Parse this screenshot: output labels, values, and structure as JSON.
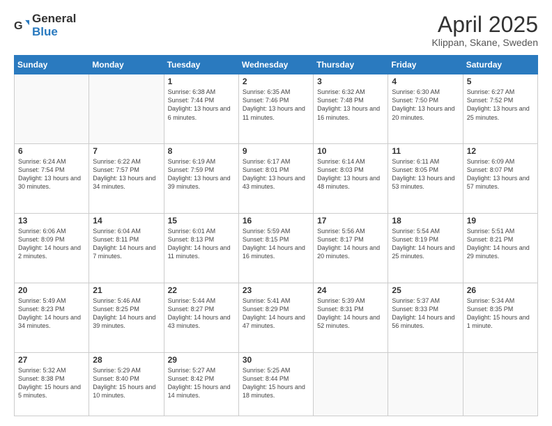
{
  "logo": {
    "general": "General",
    "blue": "Blue"
  },
  "header": {
    "title": "April 2025",
    "subtitle": "Klippan, Skane, Sweden"
  },
  "weekdays": [
    "Sunday",
    "Monday",
    "Tuesday",
    "Wednesday",
    "Thursday",
    "Friday",
    "Saturday"
  ],
  "weeks": [
    [
      {
        "day": "",
        "info": ""
      },
      {
        "day": "",
        "info": ""
      },
      {
        "day": "1",
        "info": "Sunrise: 6:38 AM\nSunset: 7:44 PM\nDaylight: 13 hours and 6 minutes."
      },
      {
        "day": "2",
        "info": "Sunrise: 6:35 AM\nSunset: 7:46 PM\nDaylight: 13 hours and 11 minutes."
      },
      {
        "day": "3",
        "info": "Sunrise: 6:32 AM\nSunset: 7:48 PM\nDaylight: 13 hours and 16 minutes."
      },
      {
        "day": "4",
        "info": "Sunrise: 6:30 AM\nSunset: 7:50 PM\nDaylight: 13 hours and 20 minutes."
      },
      {
        "day": "5",
        "info": "Sunrise: 6:27 AM\nSunset: 7:52 PM\nDaylight: 13 hours and 25 minutes."
      }
    ],
    [
      {
        "day": "6",
        "info": "Sunrise: 6:24 AM\nSunset: 7:54 PM\nDaylight: 13 hours and 30 minutes."
      },
      {
        "day": "7",
        "info": "Sunrise: 6:22 AM\nSunset: 7:57 PM\nDaylight: 13 hours and 34 minutes."
      },
      {
        "day": "8",
        "info": "Sunrise: 6:19 AM\nSunset: 7:59 PM\nDaylight: 13 hours and 39 minutes."
      },
      {
        "day": "9",
        "info": "Sunrise: 6:17 AM\nSunset: 8:01 PM\nDaylight: 13 hours and 43 minutes."
      },
      {
        "day": "10",
        "info": "Sunrise: 6:14 AM\nSunset: 8:03 PM\nDaylight: 13 hours and 48 minutes."
      },
      {
        "day": "11",
        "info": "Sunrise: 6:11 AM\nSunset: 8:05 PM\nDaylight: 13 hours and 53 minutes."
      },
      {
        "day": "12",
        "info": "Sunrise: 6:09 AM\nSunset: 8:07 PM\nDaylight: 13 hours and 57 minutes."
      }
    ],
    [
      {
        "day": "13",
        "info": "Sunrise: 6:06 AM\nSunset: 8:09 PM\nDaylight: 14 hours and 2 minutes."
      },
      {
        "day": "14",
        "info": "Sunrise: 6:04 AM\nSunset: 8:11 PM\nDaylight: 14 hours and 7 minutes."
      },
      {
        "day": "15",
        "info": "Sunrise: 6:01 AM\nSunset: 8:13 PM\nDaylight: 14 hours and 11 minutes."
      },
      {
        "day": "16",
        "info": "Sunrise: 5:59 AM\nSunset: 8:15 PM\nDaylight: 14 hours and 16 minutes."
      },
      {
        "day": "17",
        "info": "Sunrise: 5:56 AM\nSunset: 8:17 PM\nDaylight: 14 hours and 20 minutes."
      },
      {
        "day": "18",
        "info": "Sunrise: 5:54 AM\nSunset: 8:19 PM\nDaylight: 14 hours and 25 minutes."
      },
      {
        "day": "19",
        "info": "Sunrise: 5:51 AM\nSunset: 8:21 PM\nDaylight: 14 hours and 29 minutes."
      }
    ],
    [
      {
        "day": "20",
        "info": "Sunrise: 5:49 AM\nSunset: 8:23 PM\nDaylight: 14 hours and 34 minutes."
      },
      {
        "day": "21",
        "info": "Sunrise: 5:46 AM\nSunset: 8:25 PM\nDaylight: 14 hours and 39 minutes."
      },
      {
        "day": "22",
        "info": "Sunrise: 5:44 AM\nSunset: 8:27 PM\nDaylight: 14 hours and 43 minutes."
      },
      {
        "day": "23",
        "info": "Sunrise: 5:41 AM\nSunset: 8:29 PM\nDaylight: 14 hours and 47 minutes."
      },
      {
        "day": "24",
        "info": "Sunrise: 5:39 AM\nSunset: 8:31 PM\nDaylight: 14 hours and 52 minutes."
      },
      {
        "day": "25",
        "info": "Sunrise: 5:37 AM\nSunset: 8:33 PM\nDaylight: 14 hours and 56 minutes."
      },
      {
        "day": "26",
        "info": "Sunrise: 5:34 AM\nSunset: 8:35 PM\nDaylight: 15 hours and 1 minute."
      }
    ],
    [
      {
        "day": "27",
        "info": "Sunrise: 5:32 AM\nSunset: 8:38 PM\nDaylight: 15 hours and 5 minutes."
      },
      {
        "day": "28",
        "info": "Sunrise: 5:29 AM\nSunset: 8:40 PM\nDaylight: 15 hours and 10 minutes."
      },
      {
        "day": "29",
        "info": "Sunrise: 5:27 AM\nSunset: 8:42 PM\nDaylight: 15 hours and 14 minutes."
      },
      {
        "day": "30",
        "info": "Sunrise: 5:25 AM\nSunset: 8:44 PM\nDaylight: 15 hours and 18 minutes."
      },
      {
        "day": "",
        "info": ""
      },
      {
        "day": "",
        "info": ""
      },
      {
        "day": "",
        "info": ""
      }
    ]
  ]
}
